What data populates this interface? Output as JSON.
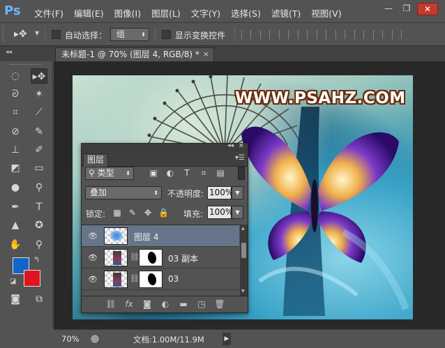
{
  "app": {
    "logo": "Ps"
  },
  "menu": [
    "文件(F)",
    "编辑(E)",
    "图像(I)",
    "图层(L)",
    "文字(Y)",
    "选择(S)",
    "滤镜(T)",
    "视图(V)"
  ],
  "window_controls": {
    "minimize": "—",
    "restore": "❐",
    "close": "✕"
  },
  "options_bar": {
    "tool_icon": "move-tool-icon",
    "auto_select_label": "自动选择：",
    "auto_select_value": "组",
    "show_transform_label": "显示变换控件"
  },
  "document_tab": {
    "title": "未标题-1 @ 70% (图层 4, RGB/8) *",
    "close": "×"
  },
  "canvas": {
    "watermark": "WWW.PSAHZ.COM"
  },
  "tools": [
    "marquee-tool-icon",
    "move-tool-icon",
    "lasso-tool-icon",
    "magic-wand-tool-icon",
    "crop-tool-icon",
    "eyedropper-tool-icon",
    "healing-brush-tool-icon",
    "brush-tool-icon",
    "clone-stamp-tool-icon",
    "history-brush-tool-icon",
    "eraser-tool-icon",
    "gradient-tool-icon",
    "blur-tool-icon",
    "dodge-tool-icon",
    "pen-tool-icon",
    "type-tool-icon",
    "path-selection-tool-icon",
    "custom-shape-tool-icon",
    "hand-tool-icon",
    "zoom-tool-icon"
  ],
  "colors": {
    "foreground": "#1565c8",
    "background": "#e0141e",
    "accent": "#667589"
  },
  "layers_panel": {
    "tab_label": "图层",
    "filter_value": "类型",
    "blend_mode": "叠加",
    "opacity_label": "不透明度:",
    "opacity_value": "100%",
    "lock_label": "锁定:",
    "fill_label": "填充:",
    "fill_value": "100%",
    "layers": [
      {
        "name": "图层 4",
        "selected": true
      },
      {
        "name": "03 副本",
        "selected": false
      },
      {
        "name": "03",
        "selected": false
      }
    ]
  },
  "status": {
    "zoom": "70%",
    "doc_info": "文档:1.00M/11.9M"
  }
}
